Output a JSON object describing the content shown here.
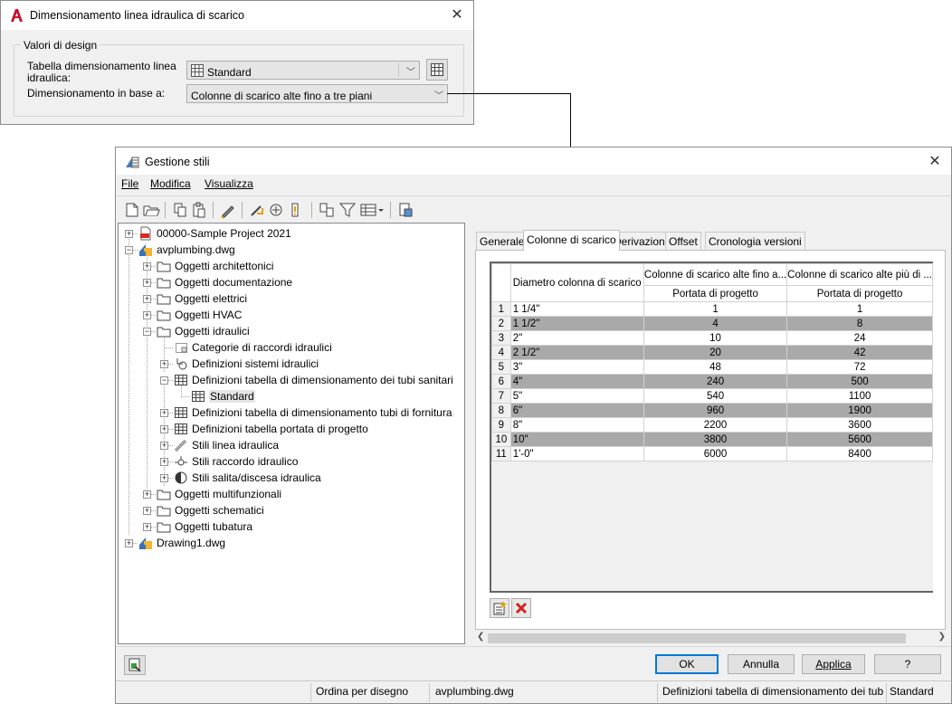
{
  "dialog1": {
    "title": "Dimensionamento linea idraulica di scarico",
    "group_label": "Valori di design",
    "table_label_line1": "Tabella dimensionamento linea",
    "table_label_line2": "idraulica:",
    "table_value": "Standard",
    "basis_label": "Dimensionamento in base a:",
    "basis_value": "Colonne di scarico alte fino a tre piani"
  },
  "dialog2": {
    "title": "Gestione stili",
    "menu": [
      "File",
      "Modifica",
      "Visualizza"
    ],
    "tree": [
      {
        "label": "00000-Sample Project 2021"
      },
      {
        "label": "avplumbing.dwg"
      },
      {
        "label": "Oggetti architettonici"
      },
      {
        "label": "Oggetti documentazione"
      },
      {
        "label": "Oggetti elettrici"
      },
      {
        "label": "Oggetti HVAC"
      },
      {
        "label": "Oggetti idraulici"
      },
      {
        "label": "Categorie di raccordi idraulici"
      },
      {
        "label": "Definizioni sistemi idraulici"
      },
      {
        "label": "Definizioni tabella di dimensionamento dei tubi sanitari"
      },
      {
        "label": "Standard"
      },
      {
        "label": "Definizioni tabella di dimensionamento tubi di fornitura"
      },
      {
        "label": "Definizioni tabella portata di progetto"
      },
      {
        "label": "Stili linea idraulica"
      },
      {
        "label": "Stili raccordo idraulico"
      },
      {
        "label": "Stili salita/discesa idraulica"
      },
      {
        "label": "Oggetti multifunzionali"
      },
      {
        "label": "Oggetti schematici"
      },
      {
        "label": "Oggetti tubatura"
      },
      {
        "label": "Drawing1.dwg"
      }
    ],
    "tabs": [
      "Generale",
      "Colonne di scarico",
      "Derivazioni",
      "Offset",
      "Cronologia versioni"
    ],
    "grid": {
      "col1_header": "Diametro colonna di scarico",
      "col2_header": "Colonne di scarico alte fino a...",
      "col3_header": "Colonne di scarico alte più di ...",
      "col2_sub": "Portata di progetto",
      "col3_sub": "Portata di progetto",
      "rows": [
        {
          "n": "1",
          "d": "1 1/4\"",
          "a": "1",
          "b": "1"
        },
        {
          "n": "2",
          "d": "1 1/2\"",
          "a": "4",
          "b": "8"
        },
        {
          "n": "3",
          "d": "2\"",
          "a": "10",
          "b": "24"
        },
        {
          "n": "4",
          "d": "2 1/2\"",
          "a": "20",
          "b": "42"
        },
        {
          "n": "5",
          "d": "3\"",
          "a": "48",
          "b": "72"
        },
        {
          "n": "6",
          "d": "4\"",
          "a": "240",
          "b": "500"
        },
        {
          "n": "7",
          "d": "5\"",
          "a": "540",
          "b": "1100"
        },
        {
          "n": "8",
          "d": "6\"",
          "a": "960",
          "b": "1900"
        },
        {
          "n": "9",
          "d": "8\"",
          "a": "2200",
          "b": "3600"
        },
        {
          "n": "10",
          "d": "10\"",
          "a": "3800",
          "b": "5600"
        },
        {
          "n": "11",
          "d": "1'-0\"",
          "a": "6000",
          "b": "8400"
        }
      ]
    },
    "buttons": {
      "ok": "OK",
      "cancel": "Annulla",
      "apply": "Applica",
      "help": "?"
    },
    "status": {
      "sort": "Ordina per disegno",
      "drawing": "avplumbing.dwg",
      "type": "Definizioni tabella di dimensionamento dei tub",
      "style": "Standard"
    }
  },
  "colors": {
    "accent": "#0078d7",
    "alt_row": "#a9a9a9",
    "autodesk_red": "#c8102e"
  }
}
